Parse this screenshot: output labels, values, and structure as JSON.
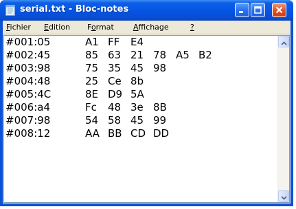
{
  "window": {
    "title": "serial.txt - Bloc-notes"
  },
  "menu": {
    "items": [
      {
        "pre": "",
        "u": "F",
        "post": "ichier"
      },
      {
        "pre": "",
        "u": "E",
        "post": "dition"
      },
      {
        "pre": "F",
        "u": "o",
        "post": "rmat"
      },
      {
        "pre": "",
        "u": "A",
        "post": "ffichage"
      },
      {
        "pre": "",
        "u": "?",
        "post": ""
      }
    ]
  },
  "document": {
    "lines": [
      {
        "addr": "#001:05",
        "bytes": [
          "A1",
          "FF",
          "E4"
        ]
      },
      {
        "addr": "#002:45",
        "bytes": [
          "85",
          "63",
          "21",
          "78",
          "A5",
          "B2"
        ]
      },
      {
        "addr": "#003:98",
        "bytes": [
          "75",
          "35",
          "45",
          "98"
        ]
      },
      {
        "addr": "#004:48",
        "bytes": [
          "25",
          "Ce",
          "8b"
        ]
      },
      {
        "addr": "#005:4C",
        "bytes": [
          "8E",
          "D9",
          "5A"
        ]
      },
      {
        "addr": "#006:a4",
        "bytes": [
          "Fc",
          "48",
          "3e",
          "8B"
        ]
      },
      {
        "addr": "#007:98",
        "bytes": [
          "54",
          "58",
          "45",
          "99"
        ]
      },
      {
        "addr": "#008:12",
        "bytes": [
          "AA",
          "BB",
          "CD",
          "DD"
        ]
      }
    ]
  },
  "colors": {
    "titlebar": "#0657e5",
    "close_button": "#e2532c",
    "menubar": "#ece9d8",
    "editor_bg": "#ffffff"
  },
  "icons": {
    "title": "notepad-icon",
    "minimize": "minimize-icon",
    "maximize": "maximize-icon",
    "close": "close-icon",
    "scroll_up": "arrow-up-icon",
    "scroll_down": "arrow-down-icon"
  }
}
